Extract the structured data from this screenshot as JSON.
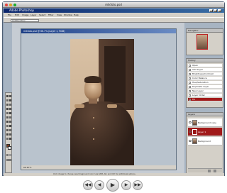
{
  "viewer": {
    "title": "mikfoto.psd"
  },
  "app": {
    "title": "Adobe Photoshop",
    "menu": [
      "File",
      "Edit",
      "Image",
      "Layer",
      "Select",
      "Filter",
      "View",
      "Window",
      "Help"
    ],
    "options_field": "Untitled-Tool"
  },
  "document": {
    "title": "mikfoto.psd @ 66.7% (Layer 1, RGB)",
    "status": "66.67%"
  },
  "panels": {
    "navigator": {
      "title": "Navigator"
    },
    "history": {
      "title": "History",
      "items": [
        "Open",
        "Add Layer",
        "Brightness/Contrast",
        "Color Balance",
        "Hue/Saturation",
        "Duplicate Layer",
        "New Layer",
        "Layer Order",
        "Fill"
      ]
    },
    "layers": {
      "title": "Layers",
      "items": [
        "Background copy",
        "Layer 1",
        "Background"
      ]
    }
  },
  "statusbar": {
    "text": "Click image to choose new foreground color. Use Shift, Alt, and Ctrl for additional options."
  },
  "controls": {
    "rewind": "◀◀",
    "prev": "◀",
    "play": "▶",
    "next": "▶",
    "forward": "▶▶"
  },
  "colors": {
    "accent": "#a11a1a",
    "titlebar": "#0a246a",
    "workspace": "#c6ccd3"
  }
}
